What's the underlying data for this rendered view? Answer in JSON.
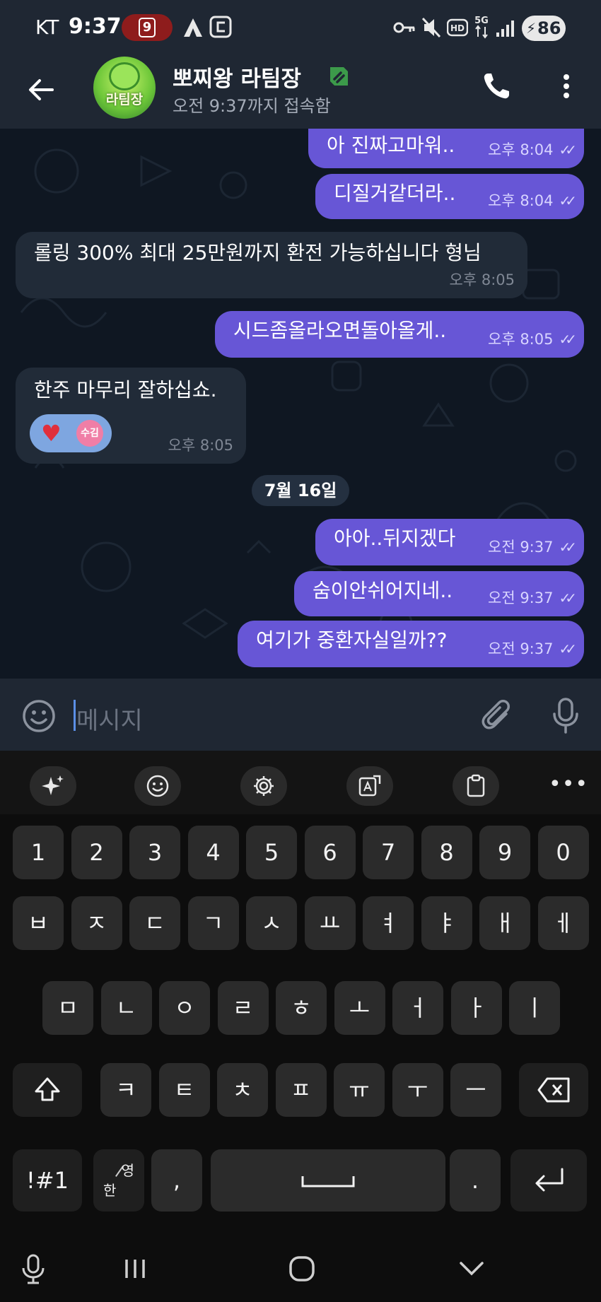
{
  "status_bar": {
    "carrier": "KT",
    "time": "9:37",
    "badge": "9",
    "hd_label": "HD",
    "network": "5G",
    "battery": "86"
  },
  "header": {
    "title": "뽀찌왕 라팀장",
    "subtitle": "오전 9:37까지 접속함",
    "avatar_text": "라팀장",
    "verified_color": "#3c9a4a"
  },
  "messages": [
    {
      "dir": "out",
      "text": "아 진짜고마워..",
      "time": "오후 8:04"
    },
    {
      "dir": "out",
      "text": "디질거같더라..",
      "time": "오후 8:04"
    },
    {
      "dir": "in",
      "text": "롤링 300% 최대 25만원까지 환전 가능하십니다 형님",
      "time": "오후 8:05"
    },
    {
      "dir": "out",
      "text": "시드좀올라오면돌아올게..",
      "time": "오후 8:05"
    },
    {
      "dir": "in",
      "text": "한주 마무리 잘하십쇼.",
      "time": "오후 8:05",
      "reaction": {
        "emoji": "♥",
        "avatar_label": "수김"
      }
    },
    {
      "dir": "out",
      "text": "아아..뒤지겠다",
      "time": "오전 9:37"
    },
    {
      "dir": "out",
      "text": "숨이안쉬어지네..",
      "time": "오전 9:37"
    },
    {
      "dir": "out",
      "text": "여기가 중환자실일까??",
      "time": "오전 9:37"
    }
  ],
  "date_separator": "7월 16일",
  "input": {
    "placeholder": "메시지"
  },
  "keyboard": {
    "row_numbers": [
      "1",
      "2",
      "3",
      "4",
      "5",
      "6",
      "7",
      "8",
      "9",
      "0"
    ],
    "row1": [
      "ㅂ",
      "ㅈ",
      "ㄷ",
      "ㄱ",
      "ㅅ",
      "ㅛ",
      "ㅕ",
      "ㅑ",
      "ㅐ",
      "ㅔ"
    ],
    "row2": [
      "ㅁ",
      "ㄴ",
      "ㅇ",
      "ㄹ",
      "ㅎ",
      "ㅗ",
      "ㅓ",
      "ㅏ",
      "ㅣ"
    ],
    "row3": [
      "ㅋ",
      "ㅌ",
      "ㅊ",
      "ㅍ",
      "ㅠ",
      "ㅜ",
      "ㅡ"
    ],
    "symbols_key": "!#1",
    "lang_top": "한",
    "lang_bottom": "영",
    "comma": ",",
    "period": "."
  },
  "colors": {
    "outgoing_bubble": "#6756d6",
    "incoming_bubble": "#212b38",
    "header_bg": "#1f2733"
  }
}
